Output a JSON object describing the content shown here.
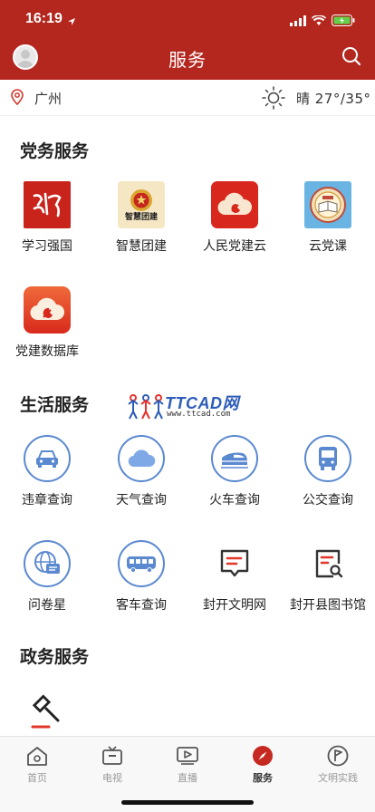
{
  "status": {
    "time": "16:19"
  },
  "header": {
    "title": "服务"
  },
  "location": {
    "city": "广州",
    "weather": "晴  27°/35°"
  },
  "sections": {
    "party": {
      "title": "党务服务",
      "items": [
        {
          "label": "学习强国",
          "icon": "xuexi-qiangguo-icon"
        },
        {
          "label": "智慧团建",
          "icon": "zhihui-tuanjian-icon",
          "badge_text": "智慧团建"
        },
        {
          "label": "人民党建云",
          "icon": "party-cloud-icon"
        },
        {
          "label": "云党课",
          "icon": "party-class-icon"
        },
        {
          "label": "党建数据库",
          "icon": "party-database-icon"
        }
      ]
    },
    "life": {
      "title": "生活服务",
      "items": [
        {
          "label": "违章查询",
          "icon": "car-icon"
        },
        {
          "label": "天气查询",
          "icon": "cloud-icon"
        },
        {
          "label": "火车查询",
          "icon": "train-icon"
        },
        {
          "label": "公交查询",
          "icon": "bus-icon"
        },
        {
          "label": "问卷星",
          "icon": "globe-chat-icon"
        },
        {
          "label": "客车查询",
          "icon": "coach-icon"
        },
        {
          "label": "封开文明网",
          "icon": "web-message-icon"
        },
        {
          "label": "封开县图书馆",
          "icon": "library-search-icon"
        }
      ]
    },
    "gov": {
      "title": "政务服务",
      "items": [
        {
          "label": "",
          "icon": "gavel-icon"
        }
      ]
    }
  },
  "watermark": {
    "brand": "TTCAD网",
    "url": "www.ttcad.com"
  },
  "tabs": [
    {
      "label": "首页",
      "icon": "home-icon"
    },
    {
      "label": "电视",
      "icon": "tv-icon"
    },
    {
      "label": "直播",
      "icon": "live-icon"
    },
    {
      "label": "服务",
      "icon": "compass-icon",
      "active": true
    },
    {
      "label": "文明实践",
      "icon": "flag-circle-icon"
    }
  ],
  "colors": {
    "brand": "#b3271f",
    "accent_blue": "#5b89d0",
    "text": "#222222"
  }
}
